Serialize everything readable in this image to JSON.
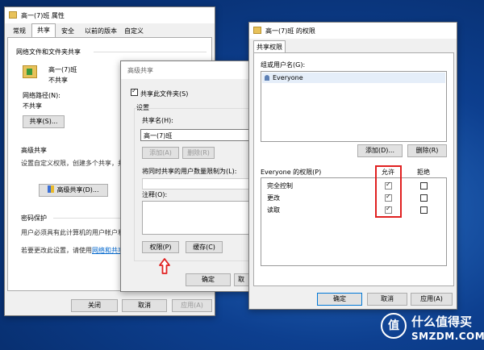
{
  "props": {
    "title": "高一(7)班 属性",
    "tabs": [
      "常规",
      "共享",
      "安全",
      "以前的版本",
      "自定义"
    ],
    "section_net": "网络文件和文件夹共享",
    "folder_name": "高一(7)班",
    "share_state": "不共享",
    "path_label": "网络路径(N):",
    "path_value": "不共享",
    "share_btn": "共享(S)...",
    "adv_heading": "高级共享",
    "adv_desc": "设置自定义权限，创建多个共享，并设",
    "adv_btn": "高级共享(D)...",
    "pwd_heading": "密码保护",
    "pwd_desc1": "用户必须具有此计算机的用户帐户和密",
    "pwd_desc2_prefix": "若要更改此设置，请使用",
    "pwd_desc2_link": "网络和共享中",
    "close_btn": "关闭",
    "cancel_btn": "取消",
    "apply_btn": "应用(A)"
  },
  "advanced": {
    "title": "高级共享",
    "share_check": "共享此文件夹(S)",
    "settings": "设置",
    "share_name_label": "共享名(H):",
    "share_name_value": "高一(7)班",
    "add_btn": "添加(A)",
    "remove_btn": "删除(R)",
    "limit_label": "将同时共享的用户数量限制为(L):",
    "comment_label": "注释(O):",
    "perm_btn": "权限(P)",
    "cache_btn": "缓存(C)",
    "ok_btn": "确定",
    "cancel_btn": "取"
  },
  "perms": {
    "title": "高一(7)班 的权限",
    "tab": "共享权限",
    "group_label": "组或用户名(G):",
    "users": [
      "Everyone"
    ],
    "add_btn": "添加(D)...",
    "remove_btn": "删除(R)",
    "perm_header": "Everyone 的权限(P)",
    "allow_header": "允许",
    "deny_header": "拒绝",
    "rows": [
      {
        "name": "完全控制",
        "allow": true,
        "deny": false
      },
      {
        "name": "更改",
        "allow": true,
        "deny": false
      },
      {
        "name": "读取",
        "allow": true,
        "deny": false
      }
    ],
    "ok_btn": "确定",
    "cancel_btn": "取消",
    "apply_btn": "应用(A)"
  },
  "watermark": {
    "text": "什么值得买",
    "sub": "SMZDM.COM",
    "badge": "值"
  },
  "colors": {
    "highlight": "#e02020",
    "link": "#0066cc",
    "desktop": "#0d3f8f"
  }
}
